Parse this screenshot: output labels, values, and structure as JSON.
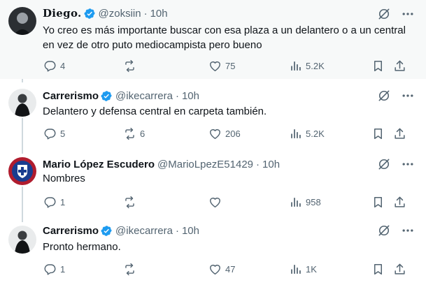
{
  "tweets": [
    {
      "name": "Diego.",
      "handle": "@zoksiin",
      "separator": "·",
      "time": "10h",
      "text": "Yo creo es más importante buscar con esa plaza a un delantero o a un central en vez de otro puto mediocampista pero bueno",
      "replies": "4",
      "retweets": "",
      "likes": "75",
      "views": "5.2K"
    },
    {
      "name": "Carrerismo",
      "handle": "@ikecarrera",
      "separator": "·",
      "time": "10h",
      "text": "Delantero y defensa central en carpeta también.",
      "replies": "5",
      "retweets": "6",
      "likes": "206",
      "views": "5.2K"
    },
    {
      "name": "Mario López Escudero",
      "handle": "@MarioLpezE51429",
      "separator": "·",
      "time": "10h",
      "text": "Nombres",
      "replies": "1",
      "retweets": "",
      "likes": "",
      "views": "958"
    },
    {
      "name": "Carrerismo",
      "handle": "@ikecarrera",
      "separator": "·",
      "time": "10h",
      "text": "Pronto hermano.",
      "replies": "1",
      "retweets": "",
      "likes": "47",
      "views": "1K"
    }
  ],
  "icons": {
    "reply": "reply-icon",
    "retweet": "retweet-icon",
    "like": "heart-icon",
    "views": "views-icon",
    "bookmark": "bookmark-icon",
    "share": "share-icon",
    "grok": "grok-icon",
    "more": "more-icon",
    "verified": "verified-badge-icon"
  },
  "colors": {
    "verified": "#1d9bf0",
    "text": "#0f1419",
    "secondary": "#536471",
    "highlight_bg": "#f7f9f9",
    "thread_line": "#cfd9de"
  }
}
